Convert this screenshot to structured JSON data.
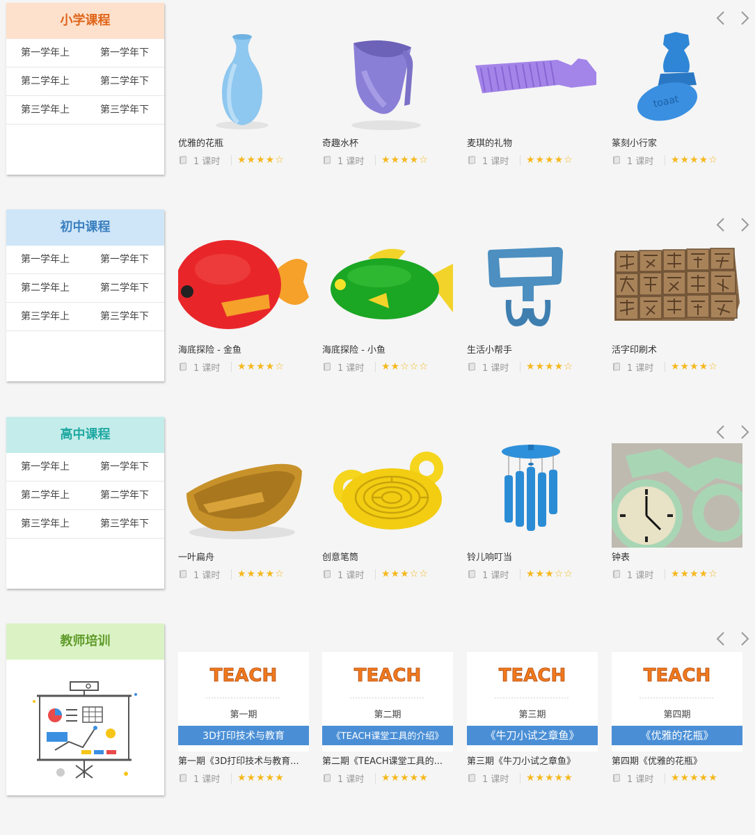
{
  "nav": {
    "prev_symbol": "‹",
    "next_symbol": "›"
  },
  "sections": [
    {
      "title": "小学课程",
      "grades": [
        [
          "第一学年上",
          "第一学年下"
        ],
        [
          "第二学年上",
          "第二学年下"
        ],
        [
          "第三学年上",
          "第三学年下"
        ]
      ],
      "cards": [
        {
          "title": "优雅的花瓶",
          "lessons": "1 课时",
          "stars": "★★★★☆",
          "rating": 4,
          "image": "blue-vase"
        },
        {
          "title": "奇趣水杯",
          "lessons": "1 课时",
          "stars": "★★★★☆",
          "rating": 4,
          "image": "purple-cup"
        },
        {
          "title": "麦琪的礼物",
          "lessons": "1 课时",
          "stars": "★★★★☆",
          "rating": 4,
          "image": "purple-comb"
        },
        {
          "title": "篆刻小行家",
          "lessons": "1 课时",
          "stars": "★★★★☆",
          "rating": 4,
          "image": "blue-seal-stamp"
        }
      ]
    },
    {
      "title": "初中课程",
      "grades": [
        [
          "第一学年上",
          "第一学年下"
        ],
        [
          "第二学年上",
          "第二学年下"
        ],
        [
          "第三学年上",
          "第三学年下"
        ]
      ],
      "cards": [
        {
          "title": "海底探险 - 金鱼",
          "lessons": "1 课时",
          "stars": "★★★★☆",
          "rating": 4,
          "image": "red-fish"
        },
        {
          "title": "海底探险 - 小鱼",
          "lessons": "1 课时",
          "stars": "★★☆☆☆",
          "rating": 2,
          "image": "green-fish"
        },
        {
          "title": "生活小帮手",
          "lessons": "1 课时",
          "stars": "★★★★☆",
          "rating": 4,
          "image": "blue-hook"
        },
        {
          "title": "活字印刷术",
          "lessons": "1 课时",
          "stars": "★★★★☆",
          "rating": 4,
          "image": "movable-type"
        }
      ]
    },
    {
      "title": "高中课程",
      "grades": [
        [
          "第一学年上",
          "第一学年下"
        ],
        [
          "第二学年上",
          "第二学年下"
        ],
        [
          "第三学年上",
          "第三学年下"
        ]
      ],
      "cards": [
        {
          "title": "一叶扁舟",
          "lessons": "1 课时",
          "stars": "★★★★☆",
          "rating": 4,
          "image": "wooden-boat"
        },
        {
          "title": "创意笔筒",
          "lessons": "1 课时",
          "stars": "★★★☆☆",
          "rating": 3,
          "image": "yellow-maze-holder"
        },
        {
          "title": "铃儿响叮当",
          "lessons": "1 课时",
          "stars": "★★★☆☆",
          "rating": 3,
          "image": "wind-chime"
        },
        {
          "title": "钟表",
          "lessons": "1 课时",
          "stars": "★★★★☆",
          "rating": 4,
          "image": "bicycle-clock"
        }
      ]
    },
    {
      "title": "教师培训",
      "cards": [
        {
          "title": "第一期《3D打印技术与教育...",
          "lessons": "1 课时",
          "stars": "★★★★★",
          "rating": 5,
          "image": "teach-poster",
          "poster_issue": "第一期",
          "poster_banner": "3D打印技术与教育"
        },
        {
          "title": "第二期《TEACH课堂工具的...",
          "lessons": "1 课时",
          "stars": "★★★★★",
          "rating": 5,
          "image": "teach-poster",
          "poster_issue": "第二期",
          "poster_banner": "《TEACH课堂工具的介绍》"
        },
        {
          "title": "第三期《牛刀小试之章鱼》",
          "lessons": "1 课时",
          "stars": "★★★★★",
          "rating": 5,
          "image": "teach-poster",
          "poster_issue": "第三期",
          "poster_banner": "《牛刀小试之章鱼》"
        },
        {
          "title": "第四期《优雅的花瓶》",
          "lessons": "1 课时",
          "stars": "★★★★★",
          "rating": 5,
          "image": "teach-poster",
          "poster_issue": "第四期",
          "poster_banner": "《优雅的花瓶》"
        }
      ]
    }
  ],
  "poster": {
    "logo": "TEACH"
  },
  "colors": {
    "star": "#f5b81d",
    "poster_banner": "#4a8fd6"
  }
}
